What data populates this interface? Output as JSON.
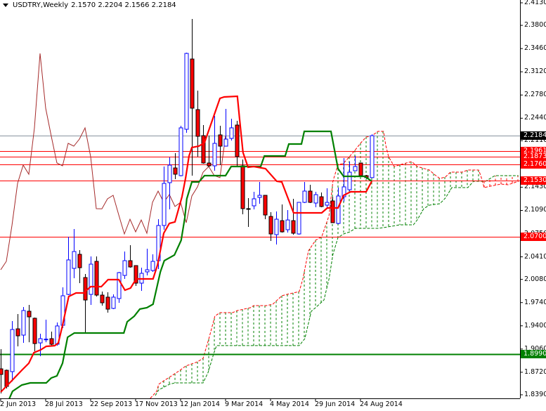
{
  "header": {
    "symbol": "USDTRY,Weekly",
    "ohlc": "2.1570 2.2204 2.1566 2.2184"
  },
  "chart_data": {
    "type": "candlestick",
    "title": "USDTRY,Weekly",
    "indicator": "Ichimoku Kinko Hyo",
    "ylim": [
      1.839,
      2.413
    ],
    "y_ticks": [
      "2.4130",
      "2.3800",
      "2.3460",
      "2.3120",
      "2.2780",
      "2.2440",
      "2.2110",
      "2.1430",
      "2.1090",
      "2.0750",
      "2.0410",
      "2.0080",
      "1.9740",
      "1.9400",
      "1.9060",
      "1.8720",
      "1.8390"
    ],
    "x_labels": [
      {
        "bar": 0,
        "label": "2 Jun 2013"
      },
      {
        "bar": 8,
        "label": "28 Jul 2013"
      },
      {
        "bar": 16,
        "label": "22 Sep 2013"
      },
      {
        "bar": 24,
        "label": "17 Nov 2013"
      },
      {
        "bar": 32,
        "label": "12 Jan 2014"
      },
      {
        "bar": 40,
        "label": "9 Mar 2014"
      },
      {
        "bar": 48,
        "label": "4 May 2014"
      },
      {
        "bar": 56,
        "label": "29 Jun 2014"
      },
      {
        "bar": 64,
        "label": "24 Aug 2014"
      }
    ],
    "candles_ohlc": [
      [
        1.877,
        1.9058,
        1.841,
        1.8688
      ],
      [
        1.8749,
        1.876,
        1.8482,
        1.8513
      ],
      [
        1.8729,
        1.947,
        1.8585,
        1.9346
      ],
      [
        1.9356,
        1.9572,
        1.9099,
        1.9253
      ],
      [
        1.9264,
        1.9675,
        1.915,
        1.9624
      ],
      [
        1.9614,
        1.9706,
        1.916,
        1.9531
      ],
      [
        1.9511,
        1.9521,
        1.9027,
        1.914
      ],
      [
        1.915,
        1.9284,
        1.8955,
        1.9212
      ],
      [
        1.9202,
        1.949,
        1.916,
        1.9205
      ],
      [
        1.9212,
        1.9315,
        1.9109,
        1.913
      ],
      [
        1.913,
        1.9449,
        1.9109,
        1.9398
      ],
      [
        1.9408,
        1.9963,
        1.9367,
        1.984
      ],
      [
        1.986,
        2.0704,
        1.985,
        2.0365
      ],
      [
        2.0241,
        2.0817,
        2.0097,
        2.0488
      ],
      [
        2.0447,
        2.0509,
        2.0025,
        2.0251
      ],
      [
        2.0107,
        2.0159,
        1.9295,
        1.9778
      ],
      [
        1.986,
        2.0416,
        1.9706,
        2.0303
      ],
      [
        2.0344,
        2.0416,
        1.983,
        1.985
      ],
      [
        1.985,
        1.9902,
        1.9696,
        1.9737
      ],
      [
        1.982,
        1.9891,
        1.9593,
        1.9644
      ],
      [
        1.9655,
        1.986,
        1.9644,
        1.982
      ],
      [
        1.9799,
        2.019,
        1.9737,
        2.0179
      ],
      [
        2.0138,
        2.0488,
        2.0087,
        2.0354
      ],
      [
        2.0354,
        2.0581,
        2.0251,
        2.0262
      ],
      [
        2.0282,
        2.0282,
        1.9984,
        2.0025
      ],
      [
        2.0025,
        2.0251,
        1.9912,
        2.0169
      ],
      [
        2.019,
        2.0529,
        2.0138,
        2.0221
      ],
      [
        2.021,
        2.0447,
        2.019,
        2.0344
      ],
      [
        2.0354,
        2.0961,
        2.0231,
        2.0869
      ],
      [
        2.0869,
        2.1733,
        2.0807,
        2.1486
      ],
      [
        2.1496,
        2.1867,
        2.1105,
        2.1753
      ],
      [
        2.1712,
        2.1928,
        2.1548,
        2.162
      ],
      [
        2.1599,
        2.233,
        2.1589,
        2.2299
      ],
      [
        2.2278,
        2.34,
        2.2227,
        2.3389
      ],
      [
        2.3307,
        2.3893,
        2.1599,
        2.2587
      ],
      [
        2.2566,
        2.2844,
        2.1877,
        2.2175
      ],
      [
        2.2185,
        2.234,
        2.1774,
        2.1784
      ],
      [
        2.1784,
        2.2185,
        2.1723,
        2.1743
      ],
      [
        2.1743,
        2.2474,
        2.1671,
        2.2072
      ],
      [
        2.2196,
        2.233,
        2.1753,
        2.2031
      ],
      [
        2.2031,
        2.2577,
        2.2031,
        2.2134
      ],
      [
        2.2144,
        2.2433,
        2.2113,
        2.2299
      ],
      [
        2.234,
        2.2402,
        2.1743,
        2.1877
      ],
      [
        2.1743,
        2.1836,
        2.1033,
        2.1116
      ],
      [
        2.1116,
        2.127,
        2.0848,
        2.1113
      ],
      [
        2.1157,
        2.1363,
        2.1105,
        2.126
      ],
      [
        2.128,
        2.1507,
        2.1188,
        2.1311
      ],
      [
        2.1311,
        2.1311,
        2.0961,
        2.1023
      ],
      [
        2.1002,
        2.1064,
        2.0642,
        2.0745
      ],
      [
        2.0735,
        2.1074,
        2.0591,
        2.0961
      ],
      [
        2.094,
        2.1177,
        2.0766,
        2.0776
      ],
      [
        2.0807,
        2.1095,
        2.0766,
        2.095
      ],
      [
        2.094,
        2.126,
        2.0735,
        2.0756
      ],
      [
        2.0745,
        2.1208,
        2.0735,
        2.1208
      ],
      [
        2.1208,
        2.1507,
        2.1198,
        2.1373
      ],
      [
        2.1373,
        2.1465,
        2.1198,
        2.1208
      ],
      [
        2.1198,
        2.1363,
        2.1136,
        2.1321
      ],
      [
        2.129,
        2.1352,
        2.1136,
        2.1147
      ],
      [
        2.1167,
        2.1414,
        2.1136,
        2.1208
      ],
      [
        2.1229,
        2.129,
        2.091,
        2.091
      ],
      [
        2.0899,
        2.1424,
        2.0889,
        2.1301
      ],
      [
        2.129,
        2.1856,
        2.1219,
        2.1435
      ],
      [
        2.1393,
        2.1805,
        2.1373,
        2.165
      ],
      [
        2.1671,
        2.1887,
        2.1671,
        2.1733
      ],
      [
        2.1784,
        2.1784,
        2.1579,
        2.1599
      ],
      [
        2.1599,
        2.1609,
        2.155,
        2.157
      ],
      [
        2.157,
        2.2204,
        2.1566,
        2.2184
      ]
    ],
    "tenkan_sen": [
      [
        0,
        1.843
      ],
      [
        1.6,
        1.8564
      ],
      [
        3.75,
        1.8749
      ],
      [
        5,
        1.8852
      ],
      [
        5.9,
        1.9007
      ],
      [
        7.1,
        1.9048
      ],
      [
        8.1,
        1.9099
      ],
      [
        9.6,
        1.9109
      ],
      [
        10.25,
        1.915
      ],
      [
        11,
        1.9408
      ],
      [
        12.1,
        1.983
      ],
      [
        13.4,
        1.9881
      ],
      [
        14.75,
        1.9881
      ],
      [
        16,
        1.9974
      ],
      [
        17.9,
        1.9974
      ],
      [
        19.1,
        2.0077
      ],
      [
        21,
        2.0077
      ],
      [
        22.1,
        1.9922
      ],
      [
        23.1,
        1.9953
      ],
      [
        24.1,
        2.0087
      ],
      [
        27.1,
        2.0087
      ],
      [
        27.9,
        2.0293
      ],
      [
        29,
        2.0756
      ],
      [
        30,
        2.09
      ],
      [
        31,
        2.0921
      ],
      [
        32.25,
        2.129
      ],
      [
        32.9,
        2.1568
      ],
      [
        33.5,
        2.1887
      ],
      [
        34,
        2.2011
      ],
      [
        35.25,
        2.2031
      ],
      [
        36.25,
        2.2083
      ],
      [
        39,
        2.2731
      ],
      [
        39.75,
        2.2751
      ],
      [
        42.1,
        2.2762
      ],
      [
        42.5,
        2.2422
      ],
      [
        43.1,
        2.1939
      ],
      [
        44,
        2.1723
      ],
      [
        45,
        2.1733
      ],
      [
        47.1,
        2.1702
      ],
      [
        49.1,
        2.1517
      ],
      [
        50,
        2.1507
      ],
      [
        52.1,
        2.1054
      ],
      [
        57.1,
        2.1054
      ],
      [
        58.1,
        2.1126
      ],
      [
        60,
        2.1126
      ],
      [
        61,
        2.1311
      ],
      [
        62.25,
        2.1363
      ],
      [
        65,
        2.1363
      ],
      [
        66,
        2.1517
      ]
    ],
    "kijun_sen": [
      [
        1.5,
        1.8328
      ],
      [
        2.1,
        1.8441
      ],
      [
        3.75,
        1.8533
      ],
      [
        5.25,
        1.8564
      ],
      [
        8.1,
        1.8564
      ],
      [
        9,
        1.8636
      ],
      [
        10,
        1.8667
      ],
      [
        11,
        1.8852
      ],
      [
        11.9,
        1.9233
      ],
      [
        13.1,
        1.9295
      ],
      [
        21.9,
        1.9295
      ],
      [
        22.5,
        1.9459
      ],
      [
        23.75,
        1.9541
      ],
      [
        24.75,
        1.9645
      ],
      [
        26,
        1.9665
      ],
      [
        27.1,
        1.9716
      ],
      [
        28.4,
        2.019
      ],
      [
        29.1,
        2.0354
      ],
      [
        30.9,
        2.0437
      ],
      [
        32.1,
        2.0653
      ],
      [
        32.75,
        2.0982
      ],
      [
        33.1,
        2.126
      ],
      [
        34,
        2.1507
      ],
      [
        35.25,
        2.1507
      ],
      [
        36.25,
        2.1599
      ],
      [
        40,
        2.1599
      ],
      [
        41,
        2.1733
      ],
      [
        46.25,
        2.1733
      ],
      [
        46.9,
        2.1887
      ],
      [
        50.6,
        2.1887
      ],
      [
        51.25,
        2.2062
      ],
      [
        53.5,
        2.2062
      ],
      [
        54,
        2.2247
      ],
      [
        58.75,
        2.2247
      ],
      [
        60,
        2.1702
      ],
      [
        61,
        2.1589
      ],
      [
        64.75,
        2.1589
      ],
      [
        66,
        2.1517
      ]
    ],
    "chikou_shift": 26,
    "senkou_span_a": [
      [
        26.6,
        1.8338
      ],
      [
        27.75,
        1.8441
      ],
      [
        28.1,
        1.8544
      ],
      [
        29,
        1.8595
      ],
      [
        30,
        1.8646
      ],
      [
        31.9,
        1.8749
      ],
      [
        32.9,
        1.8811
      ],
      [
        35,
        1.8873
      ],
      [
        36,
        1.8924
      ],
      [
        37.1,
        1.9233
      ],
      [
        38.1,
        1.9542
      ],
      [
        39,
        1.9593
      ],
      [
        41.25,
        1.9593
      ],
      [
        42.1,
        1.9624
      ],
      [
        44.4,
        1.9665
      ],
      [
        45,
        1.9696
      ],
      [
        47.25,
        1.9696
      ],
      [
        48.4,
        1.9716
      ],
      [
        50,
        1.984
      ],
      [
        51,
        1.9861
      ],
      [
        53.1,
        1.9902
      ],
      [
        53.75,
        2.0087
      ],
      [
        54.75,
        2.0498
      ],
      [
        56,
        2.0653
      ],
      [
        57.1,
        2.0704
      ],
      [
        58.4,
        2.1013
      ],
      [
        59.1,
        2.1517
      ],
      [
        60,
        2.1764
      ],
      [
        60.9,
        2.1774
      ],
      [
        61.6,
        2.1836
      ],
      [
        62.9,
        2.1959
      ],
      [
        64.1,
        2.2083
      ],
      [
        65,
        2.2165
      ],
      [
        65.9,
        2.2175
      ],
      [
        67.1,
        2.2247
      ],
      [
        68.1,
        2.2247
      ],
      [
        68.5,
        2.2042
      ],
      [
        69,
        2.1877
      ],
      [
        70,
        2.1733
      ],
      [
        71.25,
        2.1764
      ],
      [
        73.1,
        2.1805
      ],
      [
        74.1,
        2.1733
      ],
      [
        76.25,
        2.1681
      ],
      [
        77.1,
        2.162
      ],
      [
        78.1,
        2.1558
      ],
      [
        79.1,
        2.1579
      ],
      [
        80,
        2.1651
      ],
      [
        82.1,
        2.1651
      ],
      [
        83.1,
        2.1681
      ],
      [
        85,
        2.1681
      ],
      [
        85.4,
        2.1599
      ],
      [
        86,
        2.1424
      ],
      [
        87.1,
        2.1445
      ],
      [
        89,
        2.1476
      ],
      [
        90.25,
        2.1465
      ],
      [
        92.1,
        2.1517
      ]
    ],
    "senkou_span_b": [
      [
        27.5,
        1.8379
      ],
      [
        28.1,
        1.8461
      ],
      [
        30,
        1.8544
      ],
      [
        31,
        1.8564
      ],
      [
        36,
        1.8564
      ],
      [
        36.9,
        1.8719
      ],
      [
        37.9,
        1.8996
      ],
      [
        38.4,
        1.911
      ],
      [
        53.1,
        1.911
      ],
      [
        54.1,
        1.9212
      ],
      [
        55.25,
        1.9614
      ],
      [
        56,
        1.9665
      ],
      [
        57.5,
        1.9778
      ],
      [
        58.4,
        2.0087
      ],
      [
        59.1,
        2.0447
      ],
      [
        60,
        2.0694
      ],
      [
        61,
        2.0745
      ],
      [
        62.1,
        2.0776
      ],
      [
        63.1,
        2.0828
      ],
      [
        67.25,
        2.0828
      ],
      [
        69.6,
        2.0858
      ],
      [
        71,
        2.0879
      ],
      [
        73.4,
        2.0879
      ],
      [
        74.1,
        2.0951
      ],
      [
        75.25,
        2.1116
      ],
      [
        76.25,
        2.1167
      ],
      [
        78.1,
        2.1188
      ],
      [
        79.1,
        2.127
      ],
      [
        80.25,
        2.1424
      ],
      [
        83.1,
        2.1424
      ],
      [
        84.1,
        2.1517
      ],
      [
        86.25,
        2.1517
      ],
      [
        87.9,
        2.1599
      ],
      [
        92.1,
        2.1599
      ]
    ],
    "horizontal_levels": [
      {
        "price": "2.2184",
        "color": "#000000",
        "line": "#8894a0",
        "kind": "bid"
      },
      {
        "price": "2.1961",
        "color": "#ff0000",
        "line": "#ff0000"
      },
      {
        "price": "2.1873",
        "color": "#ff0000",
        "line": "#ff0000"
      },
      {
        "price": "2.1760",
        "color": "#ff0000",
        "line": "#ff0000"
      },
      {
        "price": "2.1530",
        "color": "#ff0000",
        "line": "#ff0000"
      },
      {
        "price": "2.0700",
        "color": "#ff0000",
        "line": "#ff0000"
      },
      {
        "price": "1.8990",
        "color": "#008000",
        "line": "#008000",
        "kind": "thick"
      }
    ],
    "colors": {
      "bull": "#0000ff",
      "bear_fill": "#ff0000",
      "bear_wick": "#000000",
      "tenkan": "#ff0000",
      "kijun": "#008000",
      "chikou": "#a52a2a",
      "span_a": "#ff0000",
      "span_b": "#008000"
    }
  }
}
